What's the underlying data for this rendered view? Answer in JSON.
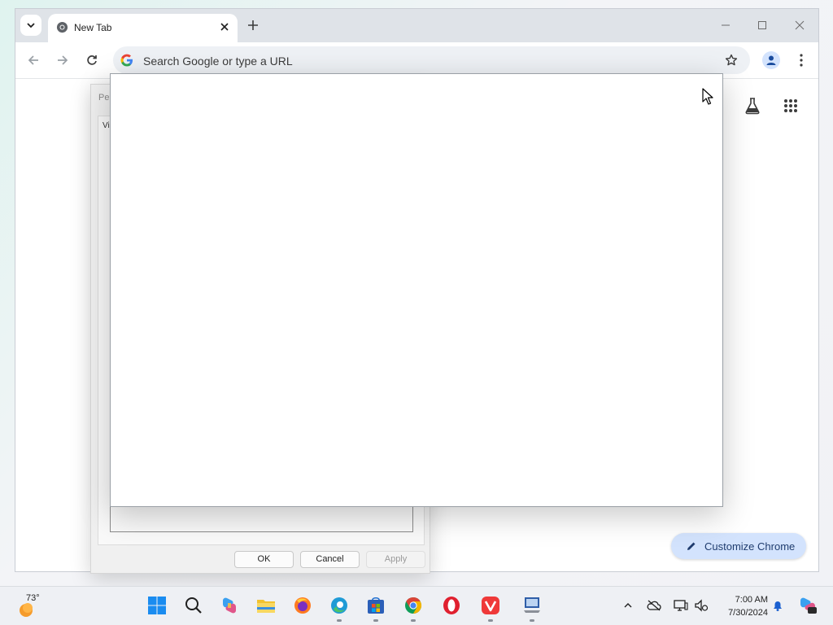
{
  "browser": {
    "tab": {
      "title": "New Tab"
    },
    "omnibox": {
      "placeholder": "Search Google or type a URL"
    },
    "customize_label": "Customize Chrome"
  },
  "dialog": {
    "title_fragment": "Per",
    "tab_fragment": "Vis",
    "buttons": {
      "ok": "OK",
      "cancel": "Cancel",
      "apply": "Apply"
    }
  },
  "taskbar": {
    "weather": {
      "temp": "73°"
    },
    "clock": {
      "time": "7:00 AM",
      "date": "7/30/2024"
    },
    "pinned": [
      "start-icon",
      "search-icon",
      "copilot-icon",
      "file-explorer-icon",
      "firefox-icon",
      "edge-icon",
      "store-icon",
      "chrome-icon",
      "opera-icon",
      "vivaldi-icon",
      "remote-desktop-icon"
    ]
  },
  "colors": {
    "accent_blue": "#1a73e8",
    "tabstrip": "#dfe3e8",
    "customize_bg": "#d3e3fd"
  }
}
